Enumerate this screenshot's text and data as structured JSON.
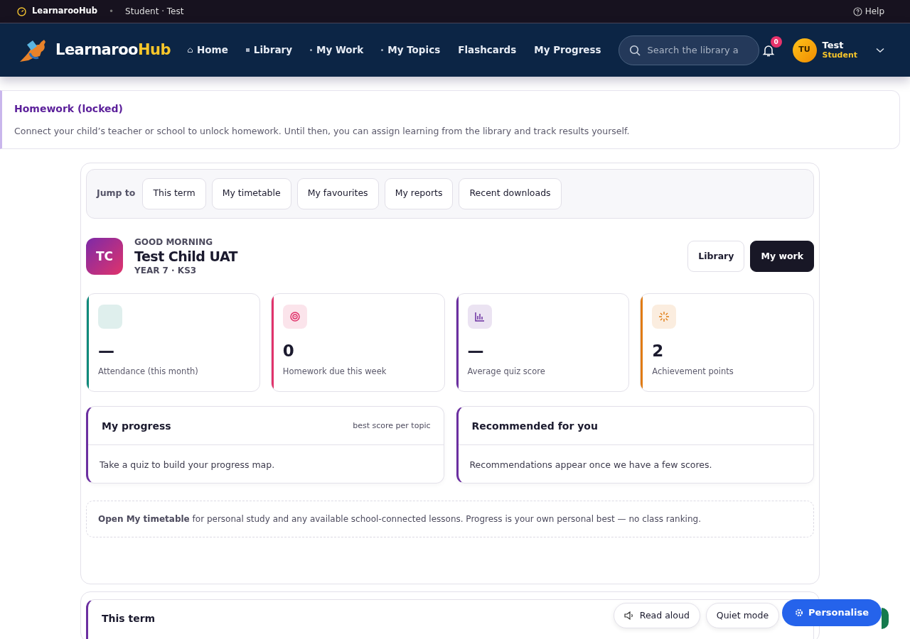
{
  "topbar": {
    "brand": "LearnarooHub",
    "separator": "•",
    "context": "Student · Test",
    "help": "Help"
  },
  "navbar": {
    "logo_main": "Learnaroo",
    "logo_accent": "Hub",
    "items": [
      {
        "label": "Home",
        "kind": "house"
      },
      {
        "label": "Library",
        "kind": "square"
      },
      {
        "label": "My Work",
        "kind": "dot"
      },
      {
        "label": "My Topics",
        "kind": "dot"
      },
      {
        "label": "Flashcards",
        "kind": "none"
      },
      {
        "label": "My Progress",
        "kind": "none"
      }
    ],
    "search": {
      "placeholder": "Search the library a"
    },
    "notifications": "0",
    "user": {
      "initials": "TU",
      "name": "Test",
      "role": "Student"
    }
  },
  "notice": {
    "title": "Homework (locked)",
    "text": "Connect your child’s teacher or school to unlock homework. Until then, you can assign learning from the library and track results yourself."
  },
  "jump": {
    "label": "Jump to",
    "links": [
      "This term",
      "My timetable",
      "My favourites",
      "My reports",
      "Recent downloads"
    ]
  },
  "greeting": {
    "initials": "TC",
    "kicker": "GOOD MORNING",
    "name": "Test Child UAT",
    "meta": "YEAR 7 · KS3",
    "buttons": [
      {
        "label": "Library",
        "kind": "outline"
      },
      {
        "label": "My work",
        "kind": "dark"
      }
    ]
  },
  "stats": [
    {
      "value": "—",
      "label": "Attendance (this month)",
      "color": "#0f8a7a",
      "kind": "blank"
    },
    {
      "value": "0",
      "label": "Homework due this week",
      "color": "#e0336b",
      "kind": "target"
    },
    {
      "value": "—",
      "label": "Average quiz score",
      "color": "#6b2fa0",
      "kind": "chart"
    },
    {
      "value": "2",
      "label": "Achievement points",
      "color": "#e07b12",
      "kind": "sparkle"
    }
  ],
  "panels": [
    {
      "title": "My progress",
      "note": "best score per topic",
      "body": "Take a quiz to build your progress map."
    },
    {
      "title": "Recommended for you",
      "body": "Recommendations appear once we have a few scores."
    }
  ],
  "tip": "**Open My timetable** for personal study and any available school-connected lessons. Progress is your own personal best — no class ranking.",
  "section": {
    "title": "This term"
  },
  "floating": {
    "read_aloud": "Read aloud",
    "quiet": "Quiet mode",
    "personalise": "Personalise"
  }
}
